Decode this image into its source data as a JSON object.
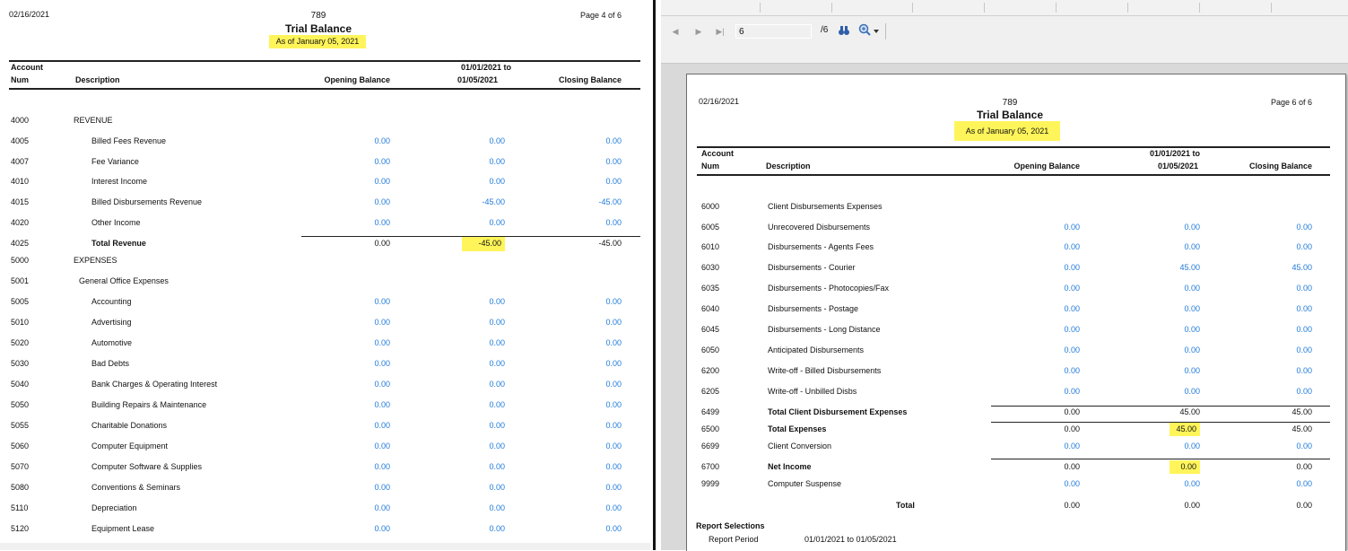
{
  "left": {
    "date": "02/16/2021",
    "firm": "789",
    "title": "Trial Balance",
    "asof": "As of January 05, 2021",
    "page": "Page 4 of 6",
    "headers": {
      "account": "Account",
      "num": "Num",
      "description": "Description",
      "opening": "Opening Balance",
      "period_top": "01/01/2021  to",
      "period_bottom": "01/05/2021",
      "closing": "Closing Balance"
    },
    "rows": [
      {
        "num": "4000",
        "desc": "REVENUE",
        "indent": 0,
        "bold": false,
        "opening": "",
        "period": "",
        "closing": "",
        "blue": false
      },
      {
        "num": "4005",
        "desc": "Billed Fees Revenue",
        "indent": 2,
        "bold": false,
        "opening": "0.00",
        "period": "0.00",
        "closing": "0.00",
        "blue": true
      },
      {
        "num": "4007",
        "desc": "Fee Variance",
        "indent": 2,
        "bold": false,
        "opening": "0.00",
        "period": "0.00",
        "closing": "0.00",
        "blue": true
      },
      {
        "num": "4010",
        "desc": "Interest Income",
        "indent": 2,
        "bold": false,
        "opening": "0.00",
        "period": "0.00",
        "closing": "0.00",
        "blue": true
      },
      {
        "num": "4015",
        "desc": "Billed Disbursements Revenue",
        "indent": 2,
        "bold": false,
        "opening": "0.00",
        "period": "-45.00",
        "closing": "-45.00",
        "blue": true
      },
      {
        "num": "4020",
        "desc": "Other Income",
        "indent": 2,
        "bold": false,
        "opening": "0.00",
        "period": "0.00",
        "closing": "0.00",
        "blue": true
      },
      {
        "num": "4025",
        "desc": "Total Revenue",
        "indent": 2,
        "bold": true,
        "opening": "0.00",
        "period": "-45.00",
        "closing": "-45.00",
        "blue": false,
        "highlight": true
      },
      {
        "num": "5000",
        "desc": "EXPENSES",
        "indent": 0,
        "bold": false,
        "opening": "",
        "period": "",
        "closing": "",
        "blue": false
      },
      {
        "num": "5001",
        "desc": "General Office Expenses",
        "indent": 1,
        "bold": false,
        "opening": "",
        "period": "",
        "closing": "",
        "blue": false
      },
      {
        "num": "5005",
        "desc": "Accounting",
        "indent": 2,
        "bold": false,
        "opening": "0.00",
        "period": "0.00",
        "closing": "0.00",
        "blue": true
      },
      {
        "num": "5010",
        "desc": "Advertising",
        "indent": 2,
        "bold": false,
        "opening": "0.00",
        "period": "0.00",
        "closing": "0.00",
        "blue": true
      },
      {
        "num": "5020",
        "desc": "Automotive",
        "indent": 2,
        "bold": false,
        "opening": "0.00",
        "period": "0.00",
        "closing": "0.00",
        "blue": true
      },
      {
        "num": "5030",
        "desc": "Bad Debts",
        "indent": 2,
        "bold": false,
        "opening": "0.00",
        "period": "0.00",
        "closing": "0.00",
        "blue": true
      },
      {
        "num": "5040",
        "desc": "Bank Charges & Operating Interest",
        "indent": 2,
        "bold": false,
        "opening": "0.00",
        "period": "0.00",
        "closing": "0.00",
        "blue": true
      },
      {
        "num": "5050",
        "desc": "Building Repairs & Maintenance",
        "indent": 2,
        "bold": false,
        "opening": "0.00",
        "period": "0.00",
        "closing": "0.00",
        "blue": true
      },
      {
        "num": "5055",
        "desc": "Charitable Donations",
        "indent": 2,
        "bold": false,
        "opening": "0.00",
        "period": "0.00",
        "closing": "0.00",
        "blue": true
      },
      {
        "num": "5060",
        "desc": "Computer Equipment",
        "indent": 2,
        "bold": false,
        "opening": "0.00",
        "period": "0.00",
        "closing": "0.00",
        "blue": true
      },
      {
        "num": "5070",
        "desc": "Computer Software & Supplies",
        "indent": 2,
        "bold": false,
        "opening": "0.00",
        "period": "0.00",
        "closing": "0.00",
        "blue": true
      },
      {
        "num": "5080",
        "desc": "Conventions & Seminars",
        "indent": 2,
        "bold": false,
        "opening": "0.00",
        "period": "0.00",
        "closing": "0.00",
        "blue": true
      },
      {
        "num": "5110",
        "desc": "Depreciation",
        "indent": 2,
        "bold": false,
        "opening": "0.00",
        "period": "0.00",
        "closing": "0.00",
        "blue": true
      },
      {
        "num": "5120",
        "desc": "Equipment Lease",
        "indent": 2,
        "bold": false,
        "opening": "0.00",
        "period": "0.00",
        "closing": "0.00",
        "blue": true
      }
    ]
  },
  "viewer": {
    "page_input": "6",
    "page_total": "/6",
    "nav": {
      "first": "◀",
      "prev": "▶",
      "next": "▶|"
    }
  },
  "right": {
    "date": "02/16/2021",
    "firm": "789",
    "title": "Trial Balance",
    "asof": "As of January 05, 2021",
    "page": "Page 6 of 6",
    "headers": {
      "account": "Account",
      "num": "Num",
      "description": "Description",
      "opening": "Opening Balance",
      "period_top": "01/01/2021  to",
      "period_bottom": "01/05/2021",
      "closing": "Closing Balance"
    },
    "rows": [
      {
        "num": "6000",
        "desc": "Client Disbursements Expenses",
        "indent": 0,
        "bold": false,
        "opening": "",
        "period": "",
        "closing": "",
        "blue": false
      },
      {
        "num": "6005",
        "desc": "Unrecovered Disbursements",
        "indent": 1,
        "bold": false,
        "opening": "0.00",
        "period": "0.00",
        "closing": "0.00",
        "blue": true
      },
      {
        "num": "6010",
        "desc": "Disbursements - Agents Fees",
        "indent": 1,
        "bold": false,
        "opening": "0.00",
        "period": "0.00",
        "closing": "0.00",
        "blue": true
      },
      {
        "num": "6030",
        "desc": "Disbursements - Courier",
        "indent": 1,
        "bold": false,
        "opening": "0.00",
        "period": "45.00",
        "closing": "45.00",
        "blue": true
      },
      {
        "num": "6035",
        "desc": "Disbursements - Photocopies/Fax",
        "indent": 1,
        "bold": false,
        "opening": "0.00",
        "period": "0.00",
        "closing": "0.00",
        "blue": true
      },
      {
        "num": "6040",
        "desc": "Disbursements - Postage",
        "indent": 1,
        "bold": false,
        "opening": "0.00",
        "period": "0.00",
        "closing": "0.00",
        "blue": true
      },
      {
        "num": "6045",
        "desc": "Disbursements - Long Distance",
        "indent": 1,
        "bold": false,
        "opening": "0.00",
        "period": "0.00",
        "closing": "0.00",
        "blue": true
      },
      {
        "num": "6050",
        "desc": "Anticipated Disbursements",
        "indent": 1,
        "bold": false,
        "opening": "0.00",
        "period": "0.00",
        "closing": "0.00",
        "blue": true
      },
      {
        "num": "6200",
        "desc": "Write-off - Billed Disbursements",
        "indent": 1,
        "bold": false,
        "opening": "0.00",
        "period": "0.00",
        "closing": "0.00",
        "blue": true
      },
      {
        "num": "6205",
        "desc": "Write-off - Unbilled Disbs",
        "indent": 1,
        "bold": false,
        "opening": "0.00",
        "period": "0.00",
        "closing": "0.00",
        "blue": true
      },
      {
        "num": "6499",
        "desc": "Total Client Disbursement Expenses",
        "indent": 1,
        "bold": true,
        "opening": "0.00",
        "period": "45.00",
        "closing": "45.00",
        "blue": false
      },
      {
        "num": "6500",
        "desc": "Total Expenses",
        "indent": 1,
        "bold": true,
        "opening": "0.00",
        "period": "45.00",
        "closing": "45.00",
        "blue": false,
        "highlight": true
      },
      {
        "num": "6699",
        "desc": "Client Conversion",
        "indent": 1,
        "bold": false,
        "opening": "0.00",
        "period": "0.00",
        "closing": "0.00",
        "blue": true
      },
      {
        "num": "6700",
        "desc": "Net Income",
        "indent": 1,
        "bold": true,
        "opening": "0.00",
        "period": "0.00",
        "closing": "0.00",
        "blue": false,
        "highlight": true
      },
      {
        "num": "9999",
        "desc": "Computer Suspense",
        "indent": 1,
        "bold": false,
        "opening": "0.00",
        "period": "0.00",
        "closing": "0.00",
        "blue": true
      }
    ],
    "total": {
      "label": "Total",
      "opening": "0.00",
      "period": "0.00",
      "closing": "0.00"
    },
    "selections": {
      "title": "Report Selections",
      "period_label": "Report Period",
      "period_value": "01/01/2021  to  01/05/2021"
    }
  },
  "colors": {
    "blue": "#1f7ad9",
    "highlight": "#fff55a"
  }
}
